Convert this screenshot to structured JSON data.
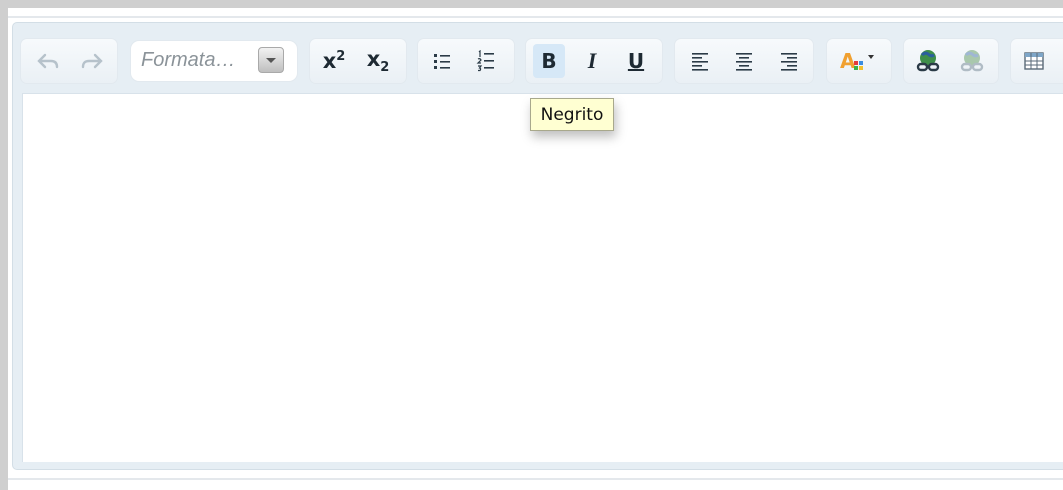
{
  "toolbar": {
    "undo_icon": "undo-icon",
    "redo_icon": "redo-icon",
    "format": {
      "value": "Formata…"
    },
    "superscript": {
      "base": "x",
      "sup": "2"
    },
    "subscript": {
      "base": "x",
      "sub": "2"
    },
    "bold_label": "B",
    "italic_label": "I",
    "underline_label": "U",
    "font_color_label": "A",
    "active_button": "bold"
  },
  "tooltip": {
    "text": "Negrito"
  },
  "colors": {
    "accent_active": "#d6e8f7",
    "tooltip_bg": "#ffffd2",
    "editor_frame": "#e6eef4"
  }
}
